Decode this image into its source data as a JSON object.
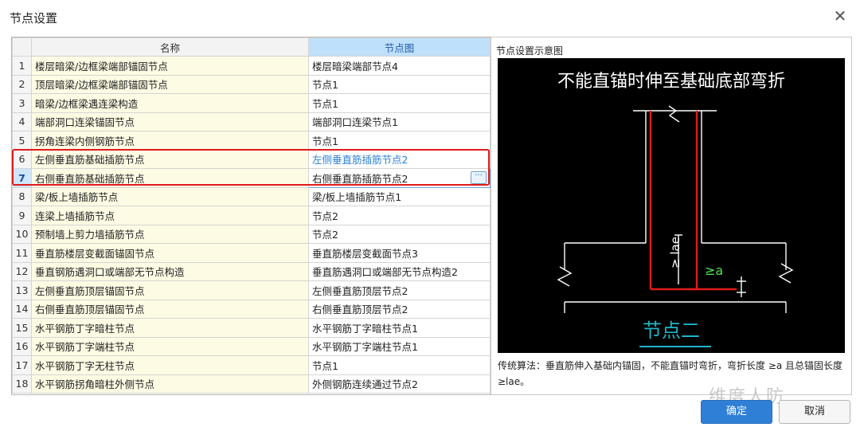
{
  "window": {
    "title": "节点设置"
  },
  "grid": {
    "headers": {
      "name": "名称",
      "node": "节点图"
    },
    "rows": [
      {
        "idx": "1",
        "name": "楼层暗梁/边框梁端部锚固节点",
        "node": "楼层暗梁端部节点4"
      },
      {
        "idx": "2",
        "name": "顶层暗梁/边框梁端部锚固节点",
        "node": "节点1"
      },
      {
        "idx": "3",
        "name": "暗梁/边框梁遇连梁构造",
        "node": "节点1"
      },
      {
        "idx": "4",
        "name": "端部洞口连梁锚固节点",
        "node": "端部洞口连梁节点1"
      },
      {
        "idx": "5",
        "name": "拐角连梁内侧钢筋节点",
        "node": "节点1"
      },
      {
        "idx": "6",
        "name": "左侧垂直筋基础插筋节点",
        "node": "左侧垂直筋插筋节点2"
      },
      {
        "idx": "7",
        "name": "右侧垂直筋基础插筋节点",
        "node": "右侧垂直筋插筋节点2"
      },
      {
        "idx": "8",
        "name": "梁/板上墙插筋节点",
        "node": "梁/板上墙插筋节点1"
      },
      {
        "idx": "9",
        "name": "连梁上墙插筋节点",
        "node": "节点2"
      },
      {
        "idx": "10",
        "name": "预制墙上剪力墙插筋节点",
        "node": "节点2"
      },
      {
        "idx": "11",
        "name": "垂直筋楼层变截面锚固节点",
        "node": "垂直筋楼层变截面节点3"
      },
      {
        "idx": "12",
        "name": "垂直钢筋遇洞口或端部无节点构造",
        "node": "垂直筋遇洞口或端部无节点构造2"
      },
      {
        "idx": "13",
        "name": "左侧垂直筋顶层锚固节点",
        "node": "左侧垂直筋顶层节点2"
      },
      {
        "idx": "14",
        "name": "右侧垂直筋顶层锚固节点",
        "node": "右侧垂直筋顶层节点2"
      },
      {
        "idx": "15",
        "name": "水平钢筋丁字暗柱节点",
        "node": "水平钢筋丁字暗柱节点1"
      },
      {
        "idx": "16",
        "name": "水平钢筋丁字端柱节点",
        "node": "水平钢筋丁字端柱节点1"
      },
      {
        "idx": "17",
        "name": "水平钢筋丁字无柱节点",
        "node": "节点1"
      },
      {
        "idx": "18",
        "name": "水平钢筋拐角暗柱外侧节点",
        "node": "外侧钢筋连续通过节点2"
      }
    ],
    "edit_button": "···"
  },
  "panel": {
    "title": "节点设置示意图",
    "diagram": {
      "heading": "不能直锚时伸至基础底部弯折",
      "label_lae": "≥ lae",
      "label_a": "≥a",
      "caption": "节点二"
    },
    "description": "传统算法：垂直筋伸入基础内锚固，不能直锚时弯折，弯折长度 ≥a 且总锚固长度 ≥lae。"
  },
  "buttons": {
    "ok": "确定",
    "cancel": "取消"
  },
  "watermark": "维度人防",
  "colors": {
    "accent": "#2f7fd6",
    "highlight": "#e01b1b",
    "rebar": "#e01b1b",
    "caption": "#1fb5c9"
  }
}
